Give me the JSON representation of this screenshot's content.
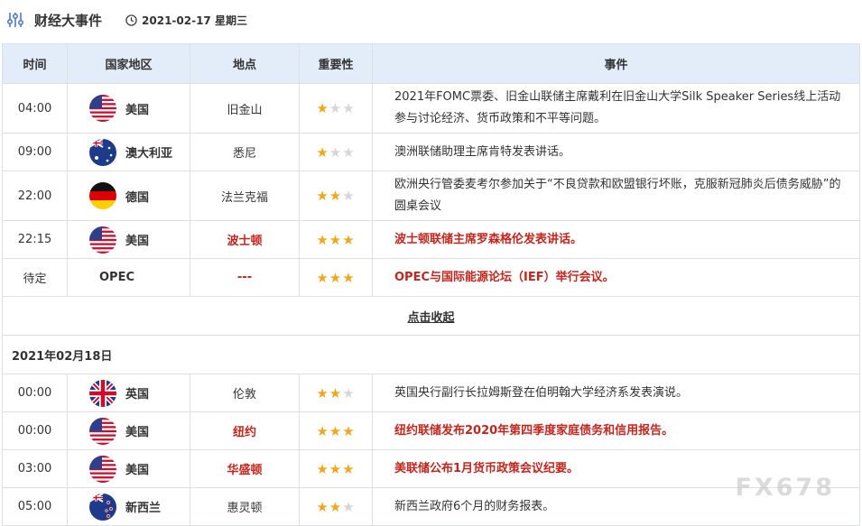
{
  "header": {
    "title": "财经大事件",
    "date": "2021-02-17 星期三"
  },
  "columns": [
    "时间",
    "国家地区",
    "地点",
    "重要性",
    "事件"
  ],
  "rows_day1": [
    {
      "time": "04:00",
      "flag": "us",
      "country": "美国",
      "place": "旧金山",
      "stars": 1,
      "highlight": false,
      "event": "2021年FOMC票委、旧金山联储主席戴利在旧金山大学Silk Speaker Series线上活动参与讨论经济、货币政策和不平等问题。"
    },
    {
      "time": "09:00",
      "flag": "au",
      "country": "澳大利亚",
      "place": "悉尼",
      "stars": 1,
      "highlight": false,
      "event": "澳洲联储助理主席肯特发表讲话。"
    },
    {
      "time": "22:00",
      "flag": "de",
      "country": "德国",
      "place": "法兰克福",
      "stars": 2,
      "highlight": false,
      "event": "欧洲央行管委麦考尔参加关于“不良贷款和欧盟银行坏账，克服新冠肺炎后债务威胁”的圆桌会议"
    },
    {
      "time": "22:15",
      "flag": "us",
      "country": "美国",
      "place": "波士顿",
      "stars": 3,
      "highlight": true,
      "event": "波士顿联储主席罗森格伦发表讲话。"
    },
    {
      "time": "待定",
      "flag": "",
      "country": "OPEC",
      "place": "---",
      "stars": 3,
      "highlight": true,
      "event": "OPEC与国际能源论坛（IEF）举行会议。"
    }
  ],
  "toggle_label": "点击收起",
  "day2_date": "2021年02月18日",
  "rows_day2": [
    {
      "time": "00:00",
      "flag": "uk",
      "country": "英国",
      "place": "伦敦",
      "stars": 2,
      "highlight": false,
      "event": "英国央行副行长拉姆斯登在伯明翰大学经济系发表演说。"
    },
    {
      "time": "00:00",
      "flag": "us",
      "country": "美国",
      "place": "纽约",
      "stars": 3,
      "highlight": true,
      "event": "纽约联储发布2020年第四季度家庭债务和信用报告。"
    },
    {
      "time": "03:00",
      "flag": "us",
      "country": "美国",
      "place": "华盛顿",
      "stars": 3,
      "highlight": true,
      "event": "美联储公布1月货币政策会议纪要。"
    },
    {
      "time": "05:00",
      "flag": "nz",
      "country": "新西兰",
      "place": "惠灵顿",
      "stars": 2,
      "highlight": false,
      "event": "新西兰政府6个月的财务报表。"
    }
  ],
  "watermark": "FX678",
  "colors": {
    "header_bg": "#e3ecf9",
    "highlight": "#c4261d",
    "star": "#f2a71b",
    "star_off": "#d6d6d6"
  }
}
